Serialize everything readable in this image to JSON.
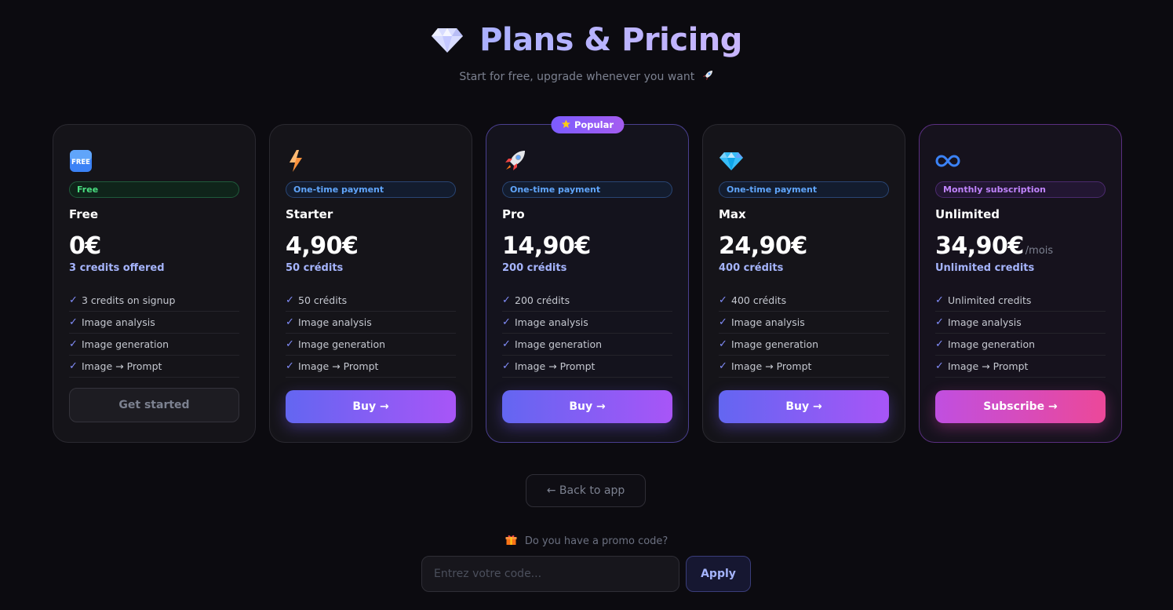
{
  "header": {
    "title": "Plans & Pricing",
    "subtitle": "Start for free, upgrade whenever you want"
  },
  "plans": [
    {
      "icon": "free-icon",
      "icon_text": "FREE",
      "pill": "Free",
      "name": "Free",
      "price": "0€",
      "per": "",
      "credits": "3 credits offered",
      "features": [
        "3 credits on signup",
        "Image analysis",
        "Image generation",
        "Image → Prompt"
      ],
      "cta": "Get started"
    },
    {
      "icon": "lightning-icon",
      "pill": "One-time payment",
      "name": "Starter",
      "price": "4,90€",
      "per": "",
      "credits": "50 crédits",
      "features": [
        "50 crédits",
        "Image analysis",
        "Image generation",
        "Image → Prompt"
      ],
      "cta": "Buy →"
    },
    {
      "icon": "rocket-icon",
      "badge": "Popular",
      "pill": "One-time payment",
      "name": "Pro",
      "price": "14,90€",
      "per": "",
      "credits": "200 crédits",
      "features": [
        "200 crédits",
        "Image analysis",
        "Image generation",
        "Image → Prompt"
      ],
      "cta": "Buy →"
    },
    {
      "icon": "diamond-icon",
      "pill": "One-time payment",
      "name": "Max",
      "price": "24,90€",
      "per": "",
      "credits": "400 crédits",
      "features": [
        "400 crédits",
        "Image analysis",
        "Image generation",
        "Image → Prompt"
      ],
      "cta": "Buy →"
    },
    {
      "icon": "infinity-icon",
      "pill": "Monthly subscription",
      "name": "Unlimited",
      "price": "34,90€",
      "per": "/mois",
      "credits": "Unlimited credits",
      "features": [
        "Unlimited credits",
        "Image analysis",
        "Image generation",
        "Image → Prompt"
      ],
      "cta": "Subscribe →"
    }
  ],
  "back_button": "← Back to app",
  "promo": {
    "question": "Do you have a promo code?",
    "placeholder": "Entrez votre code...",
    "apply": "Apply"
  },
  "colors": {
    "background": "#0c0b10",
    "accent": "#818cf8",
    "buy_gradient_start": "#6366f1",
    "buy_gradient_end": "#a855f7",
    "subscribe_gradient_start": "#c04fe0",
    "subscribe_gradient_end": "#ec4899"
  }
}
